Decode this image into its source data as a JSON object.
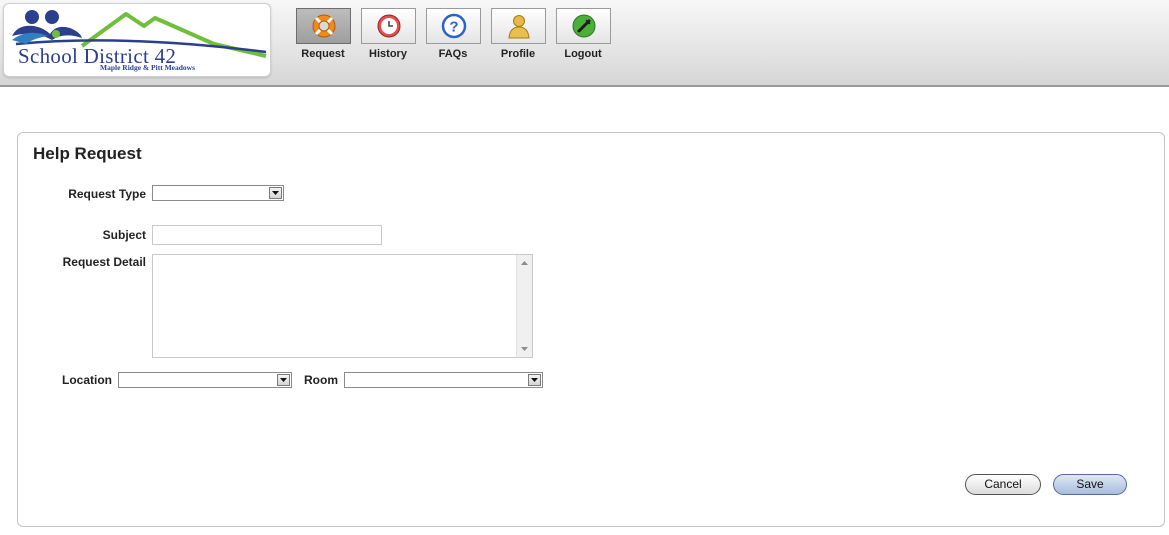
{
  "header": {
    "logo": {
      "name": "School District 42",
      "subtitle": "Maple Ridge & Pitt Meadows"
    },
    "nav": [
      {
        "label": "Request",
        "icon": "lifebuoy-icon",
        "active": true
      },
      {
        "label": "History",
        "icon": "clock-icon",
        "active": false
      },
      {
        "label": "FAQs",
        "icon": "question-icon",
        "active": false
      },
      {
        "label": "Profile",
        "icon": "user-icon",
        "active": false
      },
      {
        "label": "Logout",
        "icon": "power-icon",
        "active": false
      }
    ]
  },
  "form": {
    "title": "Help Request",
    "request_type": {
      "label": "Request Type",
      "value": ""
    },
    "subject": {
      "label": "Subject",
      "value": ""
    },
    "request_detail": {
      "label": "Request Detail",
      "value": ""
    },
    "location": {
      "label": "Location",
      "value": ""
    },
    "room": {
      "label": "Room",
      "value": ""
    },
    "cancel_label": "Cancel",
    "save_label": "Save"
  },
  "colors": {
    "brand_blue": "#2b3f8c",
    "brand_green": "#6fbf3a",
    "save_button": "#a9bcdc"
  }
}
